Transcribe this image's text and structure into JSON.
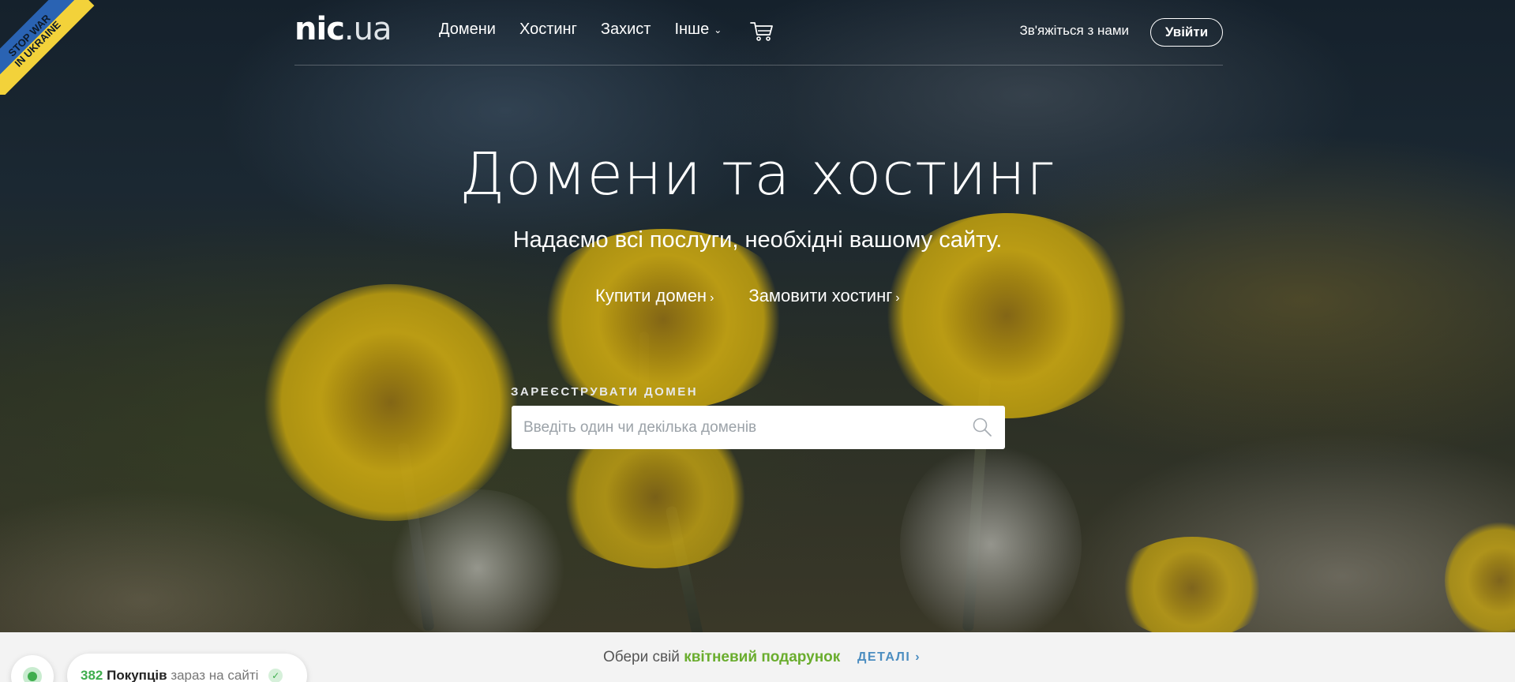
{
  "ribbon": {
    "line1": "STOP WAR",
    "line2": "IN UKRAINE"
  },
  "header": {
    "logo_main": "nic",
    "logo_tld": ".ua",
    "nav": [
      {
        "label": "Домени"
      },
      {
        "label": "Хостинг"
      },
      {
        "label": "Захист"
      },
      {
        "label": "Інше",
        "chevron": "⌄"
      }
    ],
    "cart_icon": "shopping-cart-icon",
    "contact": "Зв'яжіться з нами",
    "login": "Увійти"
  },
  "hero": {
    "title": "Домени та хостинг",
    "subtitle": "Надаємо всі послуги, необхідні вашому сайту.",
    "links": [
      {
        "label": "Купити домен",
        "arrow": "›"
      },
      {
        "label": "Замовити хостинг",
        "arrow": "›"
      }
    ],
    "register_label": "ЗАРЕЄСТРУВАТИ ДОМЕН",
    "search_placeholder": "Введіть один чи декілька доменів",
    "search_value": ""
  },
  "promo": {
    "prefix": "Обери свій",
    "highlight": "квітневий подарунок",
    "details": "ДЕТАЛІ",
    "details_arrow": "›"
  },
  "live": {
    "count": "382",
    "noun": "Покупців",
    "rest": "зараз на сайті",
    "check": "✓"
  },
  "colors": {
    "accent_green": "#6aad2e",
    "link_blue": "#4b8dc0",
    "live_green": "#3fae4e",
    "ribbon_blue": "#2a63b3",
    "ribbon_yellow": "#f3d23a"
  }
}
